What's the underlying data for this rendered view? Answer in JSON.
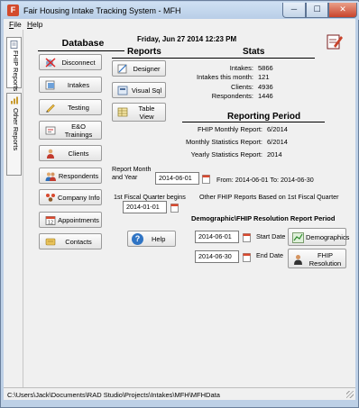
{
  "window": {
    "title": "Fair Housing Intake Tracking System  -  MFH",
    "app_icon": "app-icon",
    "controls": {
      "minimize": "─",
      "maximize": "☐",
      "close": "✕"
    }
  },
  "menu": {
    "file": {
      "mnemonic": "F",
      "rest": "ile"
    },
    "help": {
      "mnemonic": "H",
      "rest": "elp"
    }
  },
  "side_tabs": [
    {
      "label": "FHIP Reports",
      "icon": "report-icon"
    },
    {
      "label": "Other Reports",
      "icon": "chart-icon"
    }
  ],
  "database": {
    "title": "Database",
    "buttons": [
      {
        "label": "Disconnect",
        "icon": "disconnect-icon"
      },
      {
        "label": "Intakes",
        "icon": "intakes-icon"
      },
      {
        "label": "Testing",
        "icon": "testing-icon"
      },
      {
        "label": "E&O\nTrainings",
        "icon": "trainings-icon"
      },
      {
        "label": "Clients",
        "icon": "clients-icon"
      },
      {
        "label": "Respondents",
        "icon": "respondents-icon"
      },
      {
        "label": "Company Info",
        "icon": "company-icon"
      },
      {
        "label": "Appointments",
        "icon": "calendar-icon"
      },
      {
        "label": "Contacts",
        "icon": "contacts-icon"
      }
    ]
  },
  "datetime": "Friday, Jun 27 2014  12:23 PM",
  "reports": {
    "title": "Reports",
    "buttons": [
      {
        "label": "Designer",
        "icon": "designer-icon"
      },
      {
        "label": "Visual Sql",
        "icon": "sql-icon"
      },
      {
        "label": "Table\nView",
        "icon": "table-icon"
      }
    ]
  },
  "stats": {
    "title": "Stats",
    "rows": [
      {
        "label": "Intakes:",
        "value": "5866"
      },
      {
        "label": "Intakes this month:",
        "value": "121"
      },
      {
        "label": "Clients:",
        "value": "4936"
      },
      {
        "label": "Respondents:",
        "value": "1446"
      }
    ]
  },
  "reporting_period": {
    "title": "Reporting Period",
    "rows": [
      {
        "label": "FHIP Monthly Report:",
        "value": "6/2014"
      },
      {
        "label": "Monthly Statistics Report:",
        "value": "6/2014"
      },
      {
        "label": "Yearly Statistics Report:",
        "value": "2014"
      }
    ]
  },
  "report_month": {
    "label_line1": "Report Month",
    "label_line2": "and Year",
    "value": "2014-06-01",
    "range_text": "From: 2014-06-01  To: 2014-06-30"
  },
  "fiscal": {
    "label": "1st Fiscal Quarter begins",
    "value": "2014-01-01",
    "note": "Other FHIP Reports Based on 1st Fiscal Quarter"
  },
  "help_button": {
    "label": "Help",
    "icon": "help-icon"
  },
  "demographic": {
    "title": "Demographic\\FHIP Resolution Report Period",
    "start_label": "Start Date",
    "start_value": "2014-06-01",
    "end_label": "End Date",
    "end_value": "2014-06-30",
    "demographics_button": "Demographics",
    "resolution_button": "FHIP\nResolution"
  },
  "status_bar": {
    "path": "C:\\Users\\Jack\\Documents\\RAD Studio\\Projects\\Intakes\\MFH\\MFHData"
  },
  "colors": {
    "title_bar": "#bdd0e6",
    "client_bg": "#f0f0f0",
    "close_button": "#c8432b"
  }
}
